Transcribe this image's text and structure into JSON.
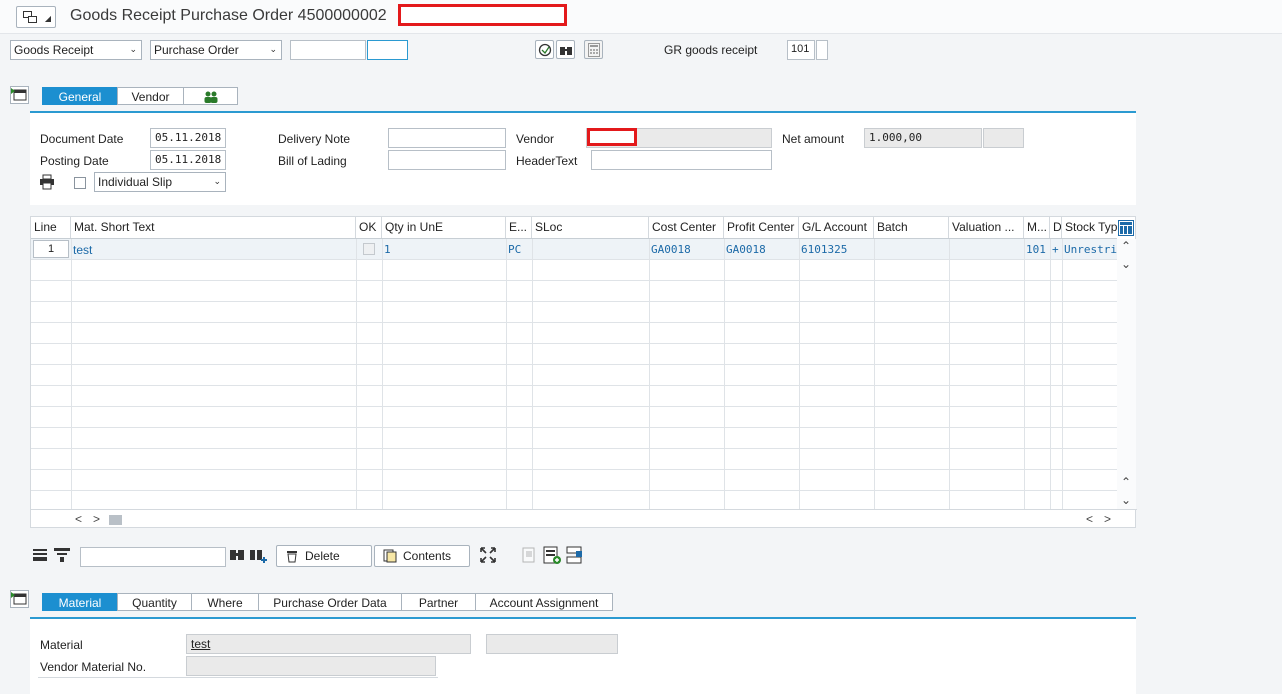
{
  "window": {
    "title": "Goods Receipt Purchase Order 4500000002"
  },
  "toolbar": {
    "transaction_select": "Goods Receipt",
    "reference_select": "Purchase Order",
    "po_number_value": "",
    "po_item_value": "",
    "movement_label": "GR goods receipt",
    "movement_type": "101"
  },
  "header_tabs": [
    "General",
    "Vendor"
  ],
  "general": {
    "document_date_label": "Document Date",
    "document_date": "05.11.2018",
    "posting_date_label": "Posting Date",
    "posting_date": "05.11.2018",
    "delivery_note_label": "Delivery Note",
    "delivery_note": "",
    "bill_of_lading_label": "Bill of Lading",
    "bill_of_lading": "",
    "vendor_label": "Vendor",
    "header_text_label": "HeaderText",
    "header_text": "",
    "net_amount_label": "Net amount",
    "net_amount": "1.000,00",
    "slip_select": "Individual Slip"
  },
  "table": {
    "columns": [
      "Line",
      "Mat. Short Text",
      "OK",
      "Qty in UnE",
      "E...",
      "SLoc",
      "Cost Center",
      "Profit Center",
      "G/L Account",
      "Batch",
      "Valuation ...",
      "M...",
      "D",
      "Stock Type"
    ],
    "rows": [
      {
        "line": "1",
        "mat_text": "test",
        "ok": "",
        "qty": "1",
        "unit": "PC",
        "sloc": "",
        "cost_center": "GA0018",
        "profit_center": "GA0018",
        "gl_account": "6101325",
        "batch": "",
        "valuation": "",
        "mvt": "101",
        "d": "+",
        "stock_type": "Unrestricted"
      }
    ]
  },
  "table_toolbar": {
    "delete_label": "Delete",
    "contents_label": "Contents",
    "search_value": ""
  },
  "detail_tabs": [
    "Material",
    "Quantity",
    "Where",
    "Purchase Order Data",
    "Partner",
    "Account Assignment"
  ],
  "material_detail": {
    "material_label": "Material",
    "material_value": "test",
    "vendor_material_label": "Vendor Material No.",
    "vendor_material_value": ""
  },
  "colors": {
    "accent": "#1c8fd0",
    "redaction": "#e3191b"
  }
}
